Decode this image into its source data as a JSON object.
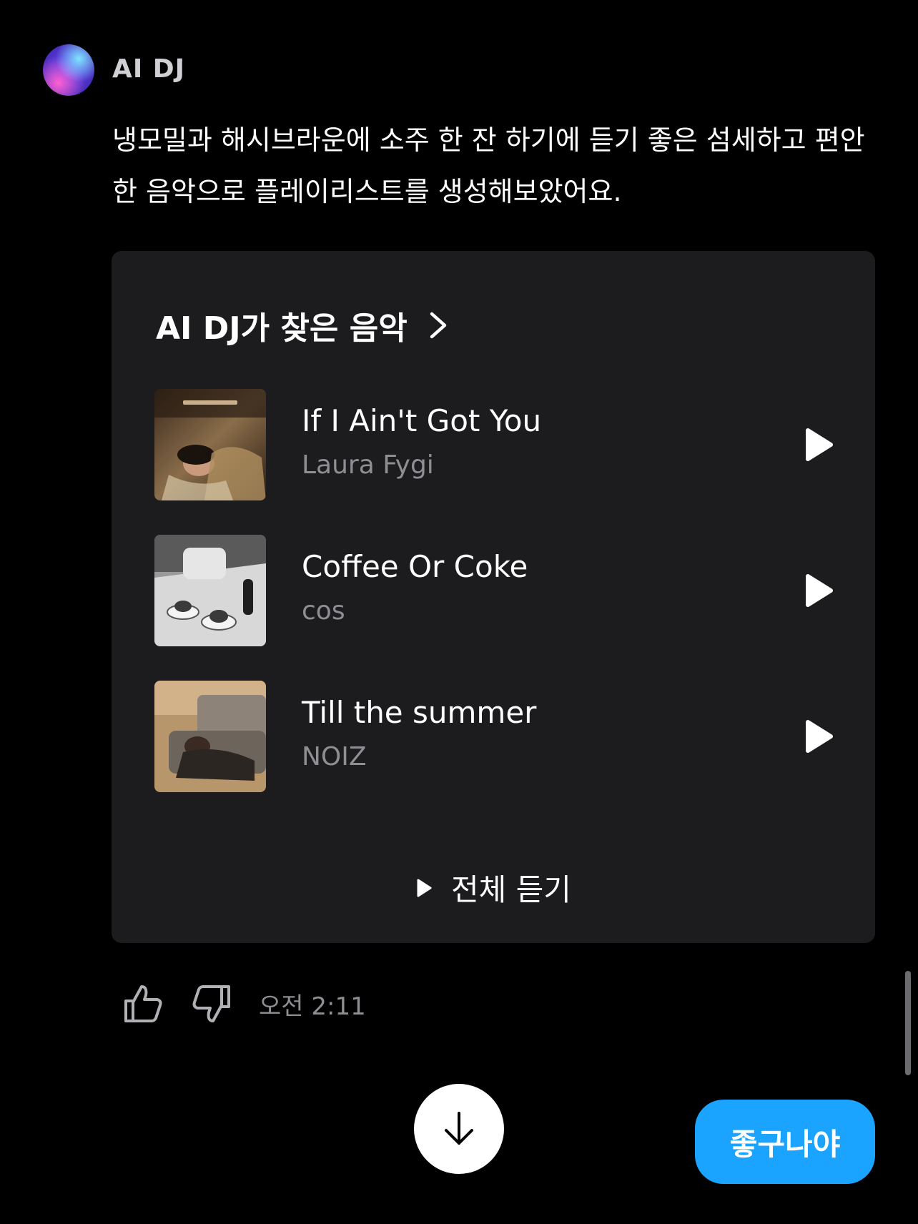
{
  "sender": {
    "name": "AI DJ",
    "avatar_icon": "ai-dj-orb-icon"
  },
  "message": {
    "text": "냉모밀과 해시브라운에 소주 한 잔 하기에 듣기 좋은 섬세하고 편안한 음악으로 플레이리스트를 생성해보았어요."
  },
  "card": {
    "title": "AI DJ가 찾은 음악",
    "tracks": [
      {
        "title": "If I Ain't Got You",
        "artist": "Laura Fygi"
      },
      {
        "title": "Coffee Or Coke",
        "artist": "cos"
      },
      {
        "title": "Till the summer",
        "artist": "NOIZ"
      }
    ],
    "play_all_label": "전체 듣기"
  },
  "feedback": {
    "timestamp": "오전 2:11"
  },
  "reply_chip": {
    "label": "좋구나야"
  },
  "colors": {
    "background": "#000000",
    "card": "#1c1c1e",
    "secondary_text": "#8e8e93",
    "accent": "#1aa3ff"
  }
}
